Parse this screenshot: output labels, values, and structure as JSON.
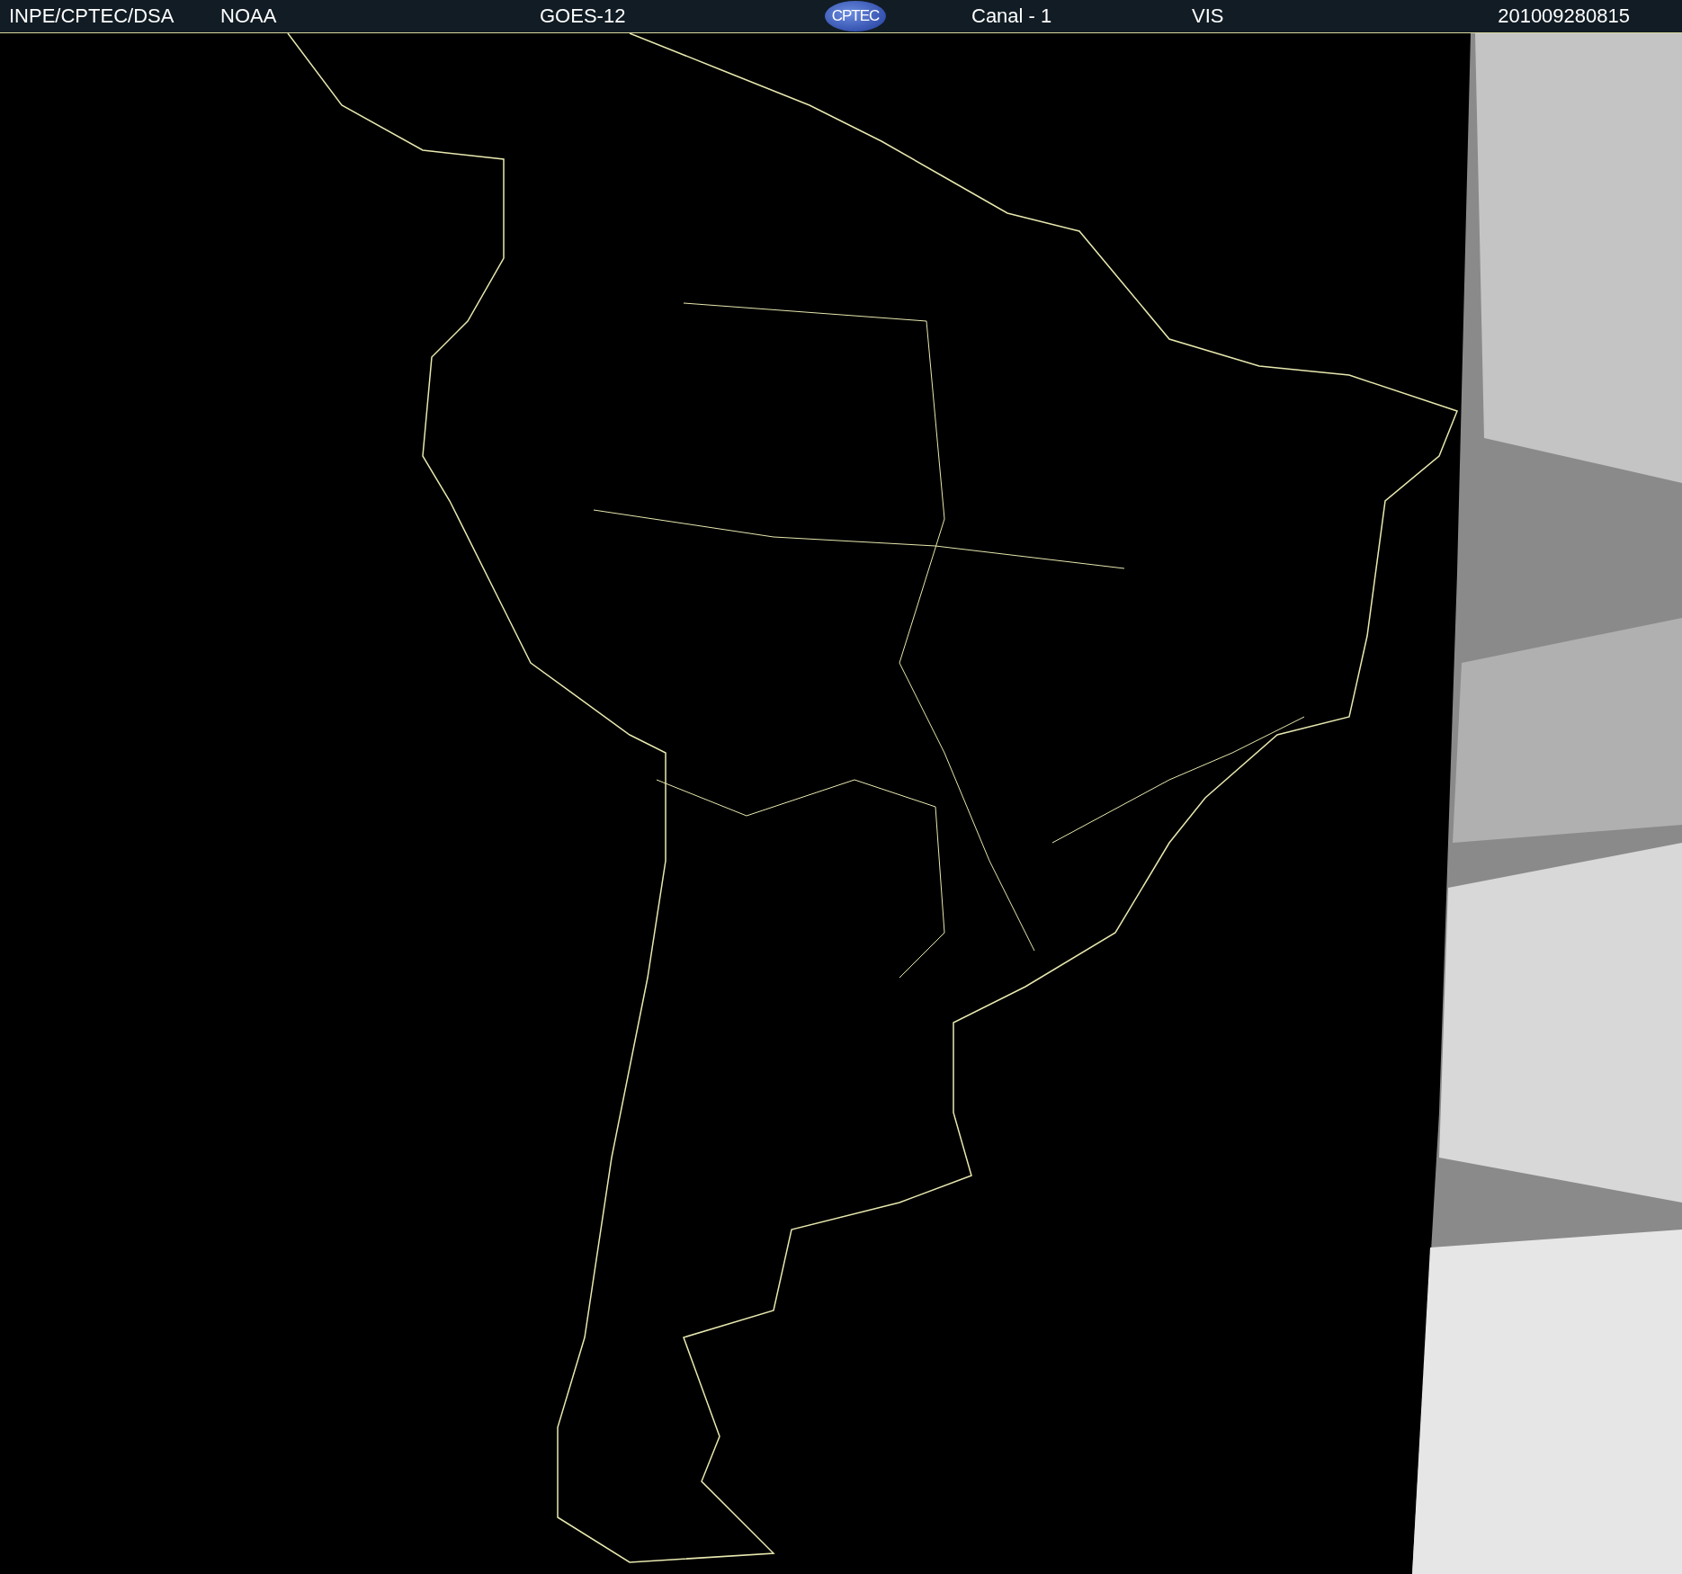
{
  "header": {
    "source": "INPE/CPTEC/DSA",
    "agency": "NOAA",
    "satellite": "GOES-12",
    "logo": "CPTEC",
    "channel": "Canal - 1",
    "band": "VIS",
    "timestamp": "201009280815"
  }
}
